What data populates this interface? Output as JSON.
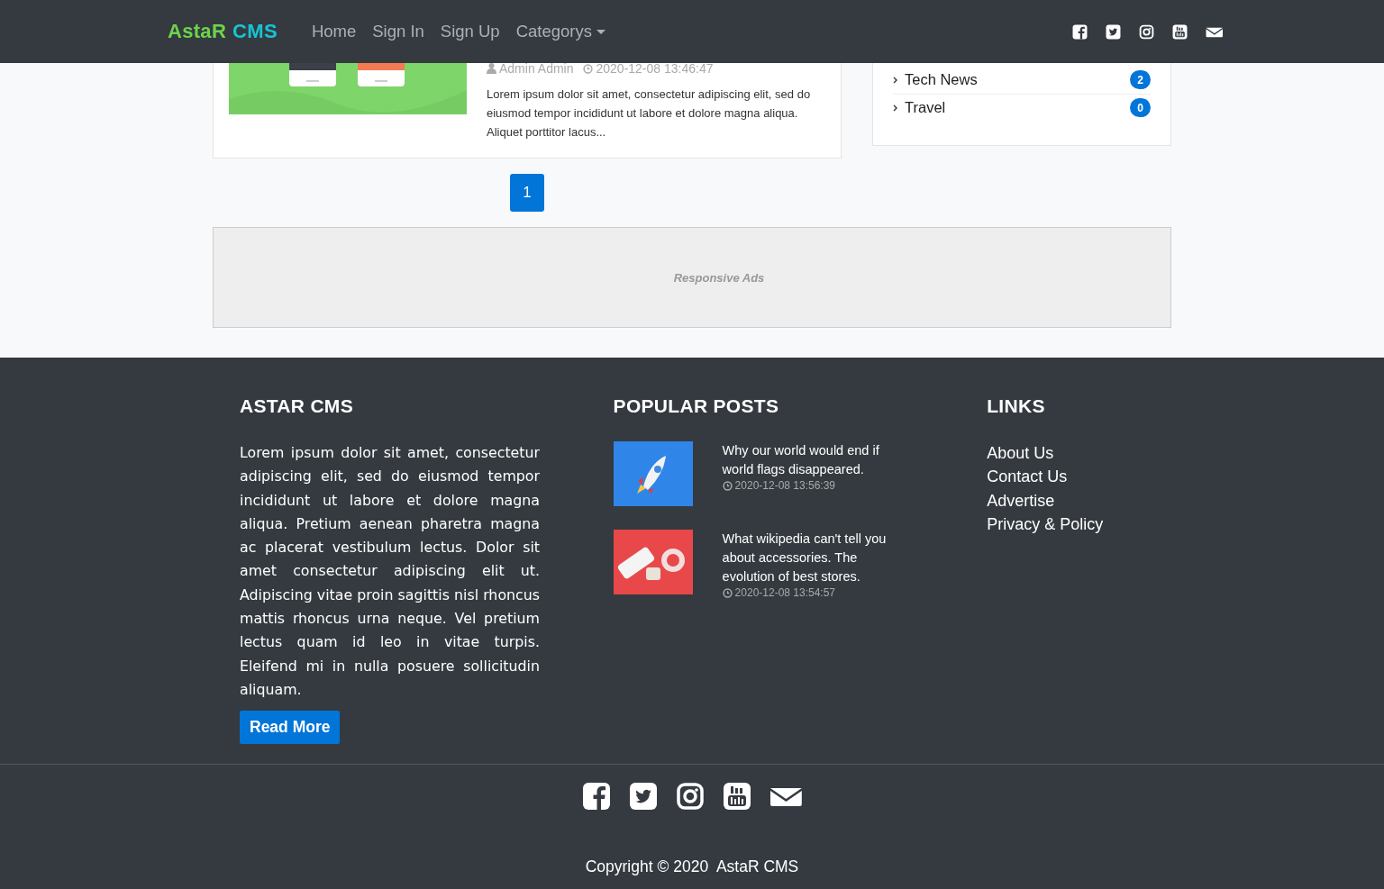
{
  "navbar": {
    "brand": {
      "first": "AstaR",
      "second": "CMS"
    },
    "links": [
      {
        "label": "Home",
        "dropdown": false
      },
      {
        "label": "Sign In",
        "dropdown": false
      },
      {
        "label": "Sign Up",
        "dropdown": false
      },
      {
        "label": "Categorys",
        "dropdown": true
      }
    ]
  },
  "post": {
    "author": "Admin Admin",
    "date": "2020-12-08 13:46:47",
    "excerpt": "Lorem ipsum dolor sit amet, consectetur adipiscing elit, sed do eiusmod tempor incididunt ut labore et dolore magna aliqua. Aliquet porttitor lacus..."
  },
  "categories": [
    {
      "name": "Tech News",
      "count": "2"
    },
    {
      "name": "Travel",
      "count": "0"
    }
  ],
  "pagination": [
    {
      "label": "1",
      "selected": true
    }
  ],
  "ad": {
    "label": "Responsive Ads"
  },
  "footer": {
    "about": {
      "heading": "ASTAR CMS",
      "text": "Lorem ipsum dolor sit amet, consectetur adipiscing elit, sed do eiusmod tempor incididunt ut labore et dolore magna aliqua. Pretium aenean pharetra magna ac placerat vestibulum lectus. Dolor sit amet consectetur adipiscing elit ut. Adipiscing vitae proin sagittis nisl rhoncus mattis rhoncus urna neque. Vel pretium lectus quam id leo in vitae turpis. Eleifend mi in nulla posuere sollicitudin aliquam.",
      "button": "Read More"
    },
    "popular": {
      "heading": "POPULAR POSTS",
      "posts": [
        {
          "title": "Why our world would end if world flags disappeared.",
          "date": "2020-12-08 13:56:39",
          "kind": "rocket"
        },
        {
          "title": "What wikipedia can't tell you about accessories. The evolution of best stores.",
          "date": "2020-12-08 13:54:57",
          "kind": "gadgets"
        }
      ]
    },
    "links": {
      "heading": "LINKS",
      "items": [
        "About Us",
        "Contact Us",
        "Advertise",
        "Privacy & Policy"
      ]
    },
    "copyright": "Copyright © 2020  AstaR CMS"
  }
}
